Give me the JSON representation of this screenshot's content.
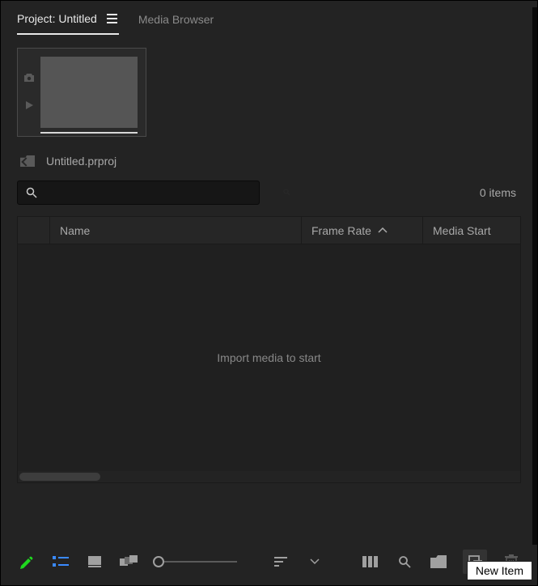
{
  "tabs": {
    "project": "Project: Untitled",
    "mediaBrowser": "Media Browser"
  },
  "project": {
    "filename": "Untitled.prproj"
  },
  "search": {
    "placeholder": "",
    "itemCount": "0 items"
  },
  "table": {
    "columns": {
      "name": "Name",
      "frameRate": "Frame Rate",
      "mediaStart": "Media Start"
    },
    "emptyMessage": "Import media to start"
  },
  "tooltip": {
    "newItem": "New Item"
  }
}
